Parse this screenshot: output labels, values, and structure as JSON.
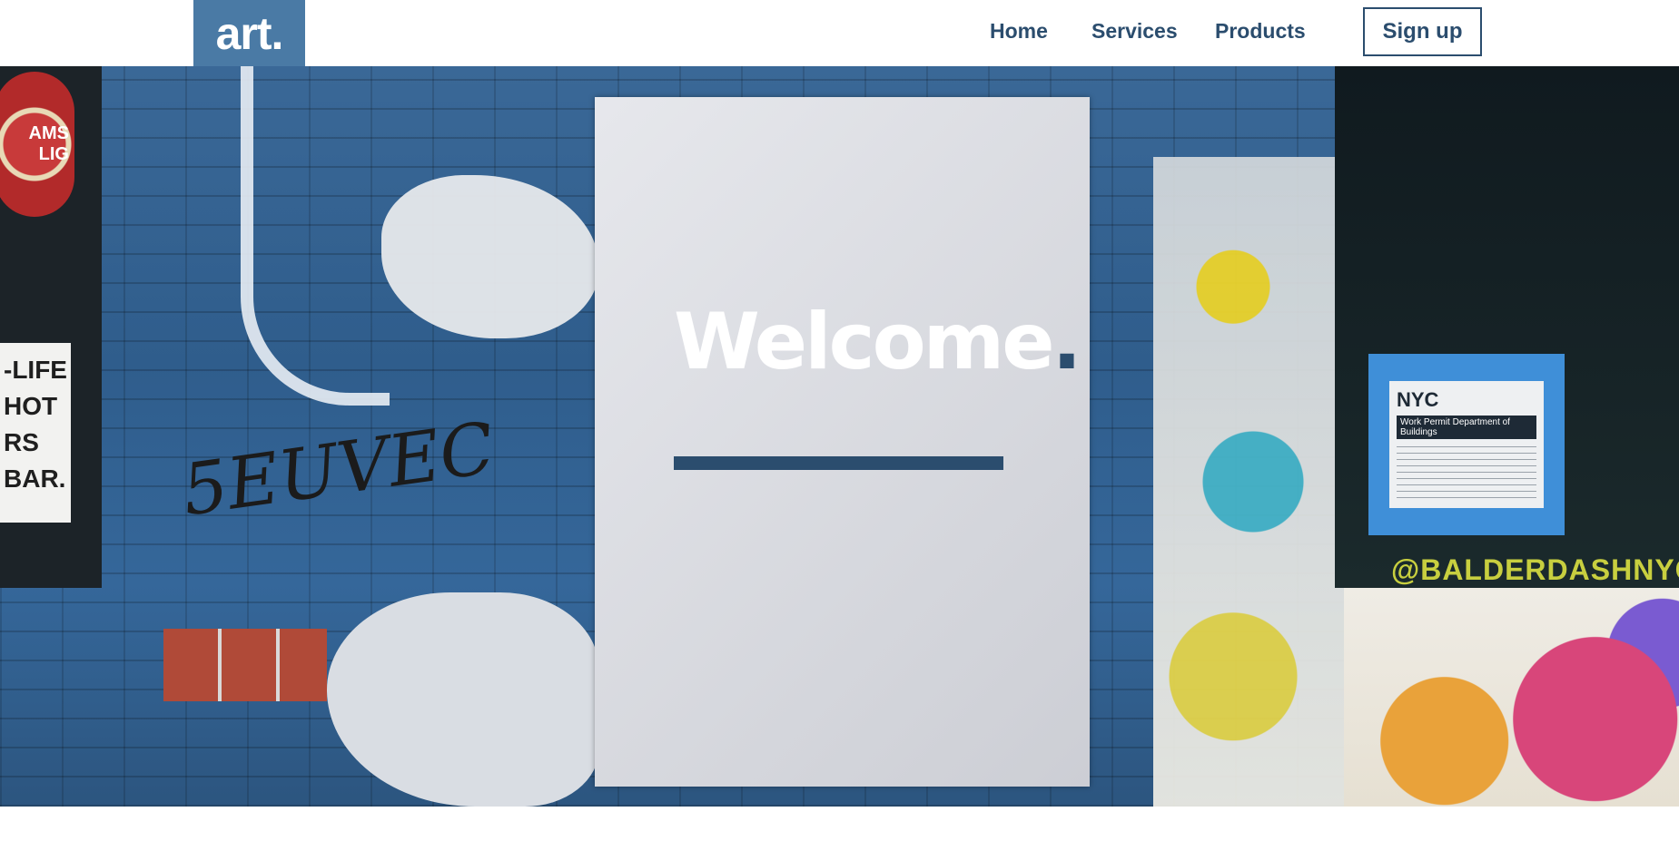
{
  "header": {
    "logo": "art.",
    "nav": [
      {
        "label": "Home"
      },
      {
        "label": "Services"
      },
      {
        "label": "Products"
      }
    ],
    "signup_label": "Sign up"
  },
  "hero": {
    "title_text": "Welcome",
    "title_dot": ".",
    "accent_color": "#2b4d6e",
    "logo_color": "#4a7aa5"
  },
  "background_art": {
    "amstel_sign": [
      "AMS",
      "LIG"
    ],
    "left_sign_lines": [
      "-LIFE",
      "HOT",
      "RS",
      "BAR."
    ],
    "graffiti_tag": "5EUVEC",
    "permit_title": "NYC",
    "permit_subtitle": "Work Permit Department of Buildings",
    "wall_tag": "@BALDERDASHNYC"
  }
}
